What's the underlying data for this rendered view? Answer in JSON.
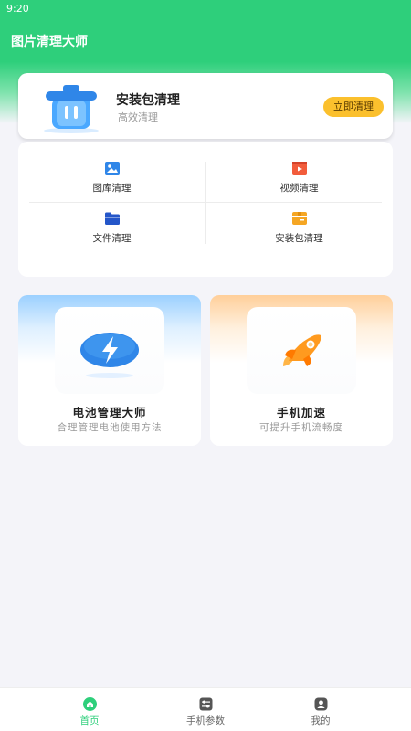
{
  "status_bar": {
    "time": "9:20"
  },
  "app": {
    "title": "图片清理大师"
  },
  "top_card": {
    "title": "安装包清理",
    "subtitle": "高效清理",
    "button": "立即清理"
  },
  "grid": {
    "items": [
      {
        "label": "图库清理",
        "icon": "gallery-icon"
      },
      {
        "label": "视频清理",
        "icon": "video-icon"
      },
      {
        "label": "文件清理",
        "icon": "folder-icon"
      },
      {
        "label": "安装包清理",
        "icon": "package-icon"
      }
    ]
  },
  "features": [
    {
      "title": "电池管理大师",
      "subtitle": "合理管理电池使用方法",
      "icon": "lightning-icon"
    },
    {
      "title": "手机加速",
      "subtitle": "可提升手机流畅度",
      "icon": "rocket-icon"
    }
  ],
  "nav": {
    "items": [
      {
        "label": "首页",
        "icon": "home-icon",
        "active": true
      },
      {
        "label": "手机参数",
        "icon": "sliders-icon",
        "active": false
      },
      {
        "label": "我的",
        "icon": "profile-icon",
        "active": false
      }
    ]
  },
  "colors": {
    "brand": "#2ecf7b",
    "button": "#fbc02d",
    "battery_accent": "#2f86e8",
    "rocket_accent": "#ff9a1f"
  }
}
